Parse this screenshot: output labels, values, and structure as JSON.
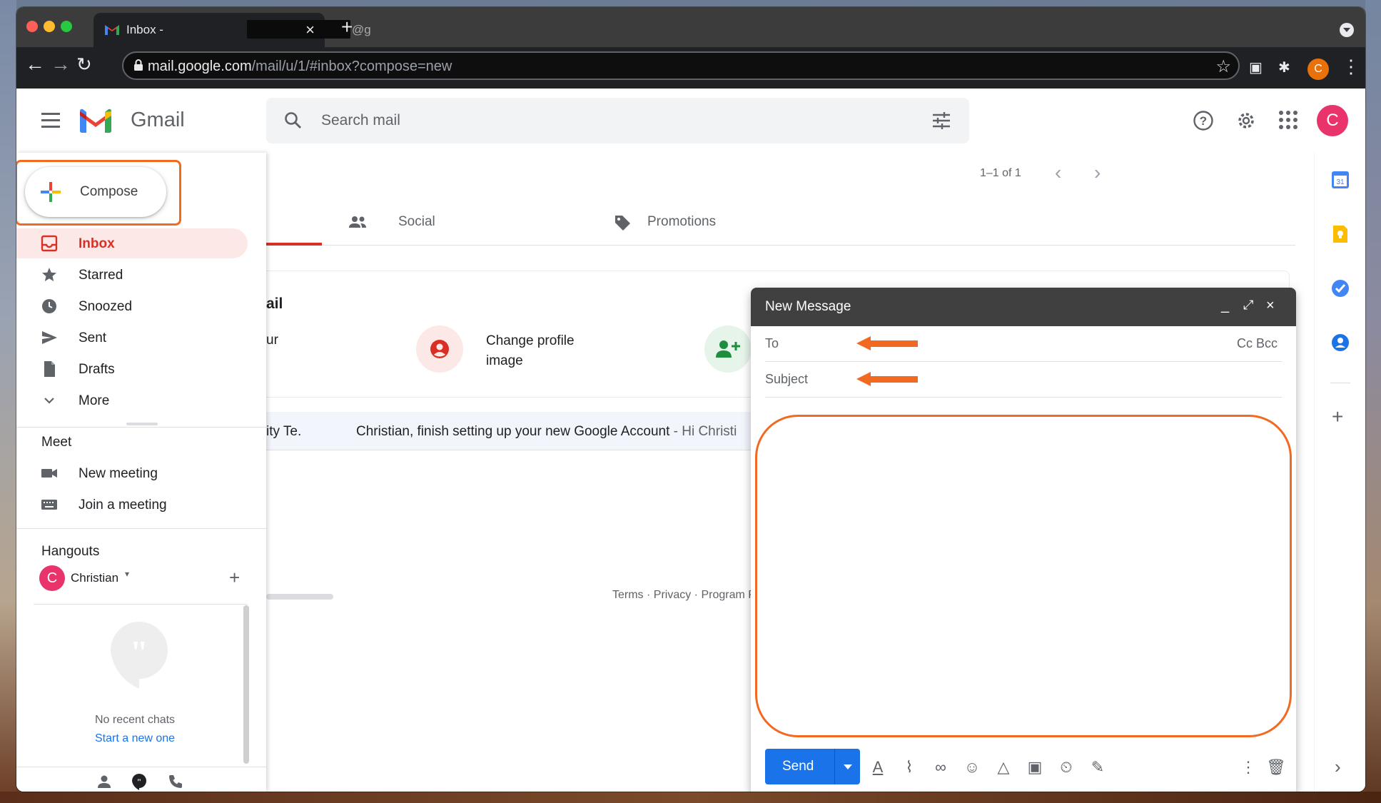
{
  "browser": {
    "tab_title": "Inbox -",
    "tab_email_fragment": "@g",
    "url_host": "mail.google.com",
    "url_path": "/mail/u/1/#inbox?compose=new",
    "profile_initial": "C"
  },
  "header": {
    "app_name": "Gmail",
    "search_placeholder": "Search mail",
    "avatar_initial": "C"
  },
  "sidebar": {
    "compose_label": "Compose",
    "items": [
      {
        "label": "Inbox",
        "icon": "inbox-icon",
        "active": true
      },
      {
        "label": "Starred",
        "icon": "star-icon"
      },
      {
        "label": "Snoozed",
        "icon": "clock-icon"
      },
      {
        "label": "Sent",
        "icon": "send-icon"
      },
      {
        "label": "Drafts",
        "icon": "draft-icon"
      },
      {
        "label": "More",
        "icon": "chevron-down-icon"
      }
    ],
    "meet": {
      "heading": "Meet",
      "new_meeting": "New meeting",
      "join_meeting": "Join a meeting"
    },
    "hangouts": {
      "heading": "Hangouts",
      "user_initial": "C",
      "user_name": "Christian",
      "no_chats": "No recent chats",
      "start_new": "Start a new one"
    }
  },
  "main": {
    "pager_text": "1–1 of 1",
    "tabs": [
      {
        "label": "Social",
        "icon": "people-icon"
      },
      {
        "label": "Promotions",
        "icon": "tag-icon"
      }
    ],
    "promo_heading_fragment": "ail",
    "promo_left_fragment": "ur",
    "promo_change_profile": "Change profile",
    "promo_change_profile_2": "image",
    "email": {
      "sender_fragment": "ity Te.",
      "subject": "Christian, finish setting up your new Google Account",
      "snippet": " - Hi Christi"
    },
    "footer": "Terms · Privacy · Program Po"
  },
  "compose": {
    "title": "New Message",
    "to_label": "To",
    "cc_bcc": "Cc Bcc",
    "subject_label": "Subject",
    "send_label": "Send"
  },
  "colors": {
    "accent_red": "#d93025",
    "send_blue": "#1a73e8",
    "annotation_orange": "#f26a21"
  }
}
